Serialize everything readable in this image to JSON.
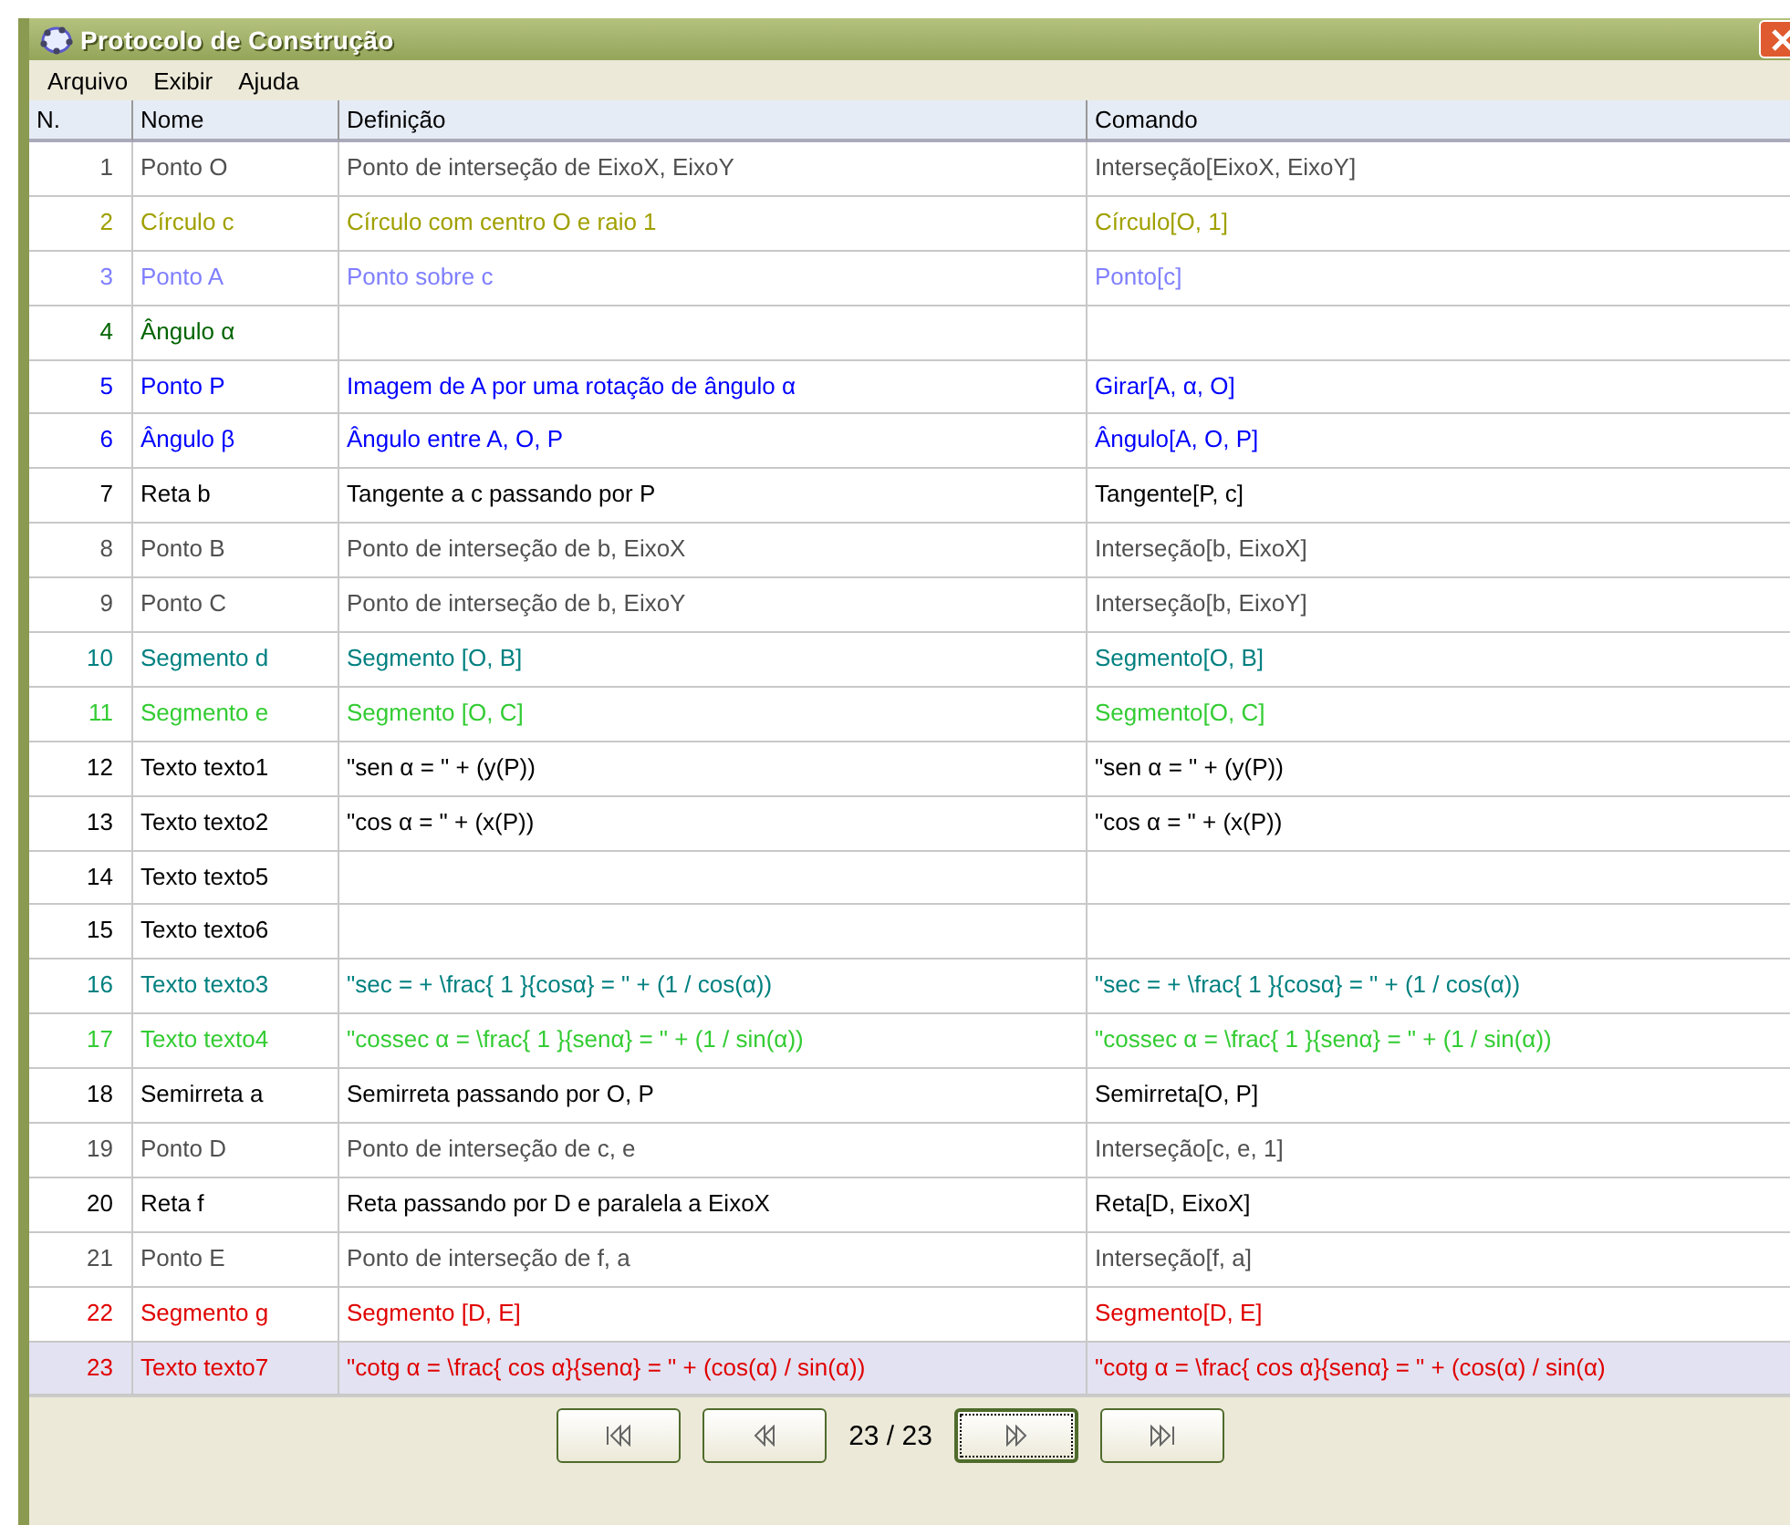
{
  "window": {
    "title": "Protocolo de Construção"
  },
  "menu": [
    "Arquivo",
    "Exibir",
    "Ajuda"
  ],
  "table": {
    "columns": [
      "N.",
      "Nome",
      "Definição",
      "Comando"
    ],
    "rows": [
      {
        "n": "1",
        "name": "Ponto O",
        "definition": "Ponto de interseção de EixoX, EixoY",
        "command": "Interseção[EixoX, EixoY]",
        "color": "#505050",
        "selected": false
      },
      {
        "n": "2",
        "name": "Círculo c",
        "definition": "Círculo com centro O e raio 1",
        "command": "Círculo[O, 1]",
        "color": "#a0a000",
        "selected": false
      },
      {
        "n": "3",
        "name": "Ponto A",
        "definition": "Ponto sobre c",
        "command": "Ponto[c]",
        "color": "#7f7fff",
        "selected": false
      },
      {
        "n": "4",
        "name": "Ângulo α",
        "definition": "",
        "command": "",
        "color": "#006400",
        "selected": false
      },
      {
        "n": "5",
        "name": "Ponto P",
        "definition": "Imagem de A por uma rotação de ângulo α",
        "command": "Girar[A, α, O]",
        "color": "#0000ff",
        "selected": false
      },
      {
        "n": "6",
        "name": "Ângulo β",
        "definition": "Ângulo entre A, O, P",
        "command": "Ângulo[A, O, P]",
        "color": "#0000ff",
        "selected": false
      },
      {
        "n": "7",
        "name": "Reta b",
        "definition": "Tangente a c passando por P",
        "command": "Tangente[P, c]",
        "color": "#000000",
        "selected": false
      },
      {
        "n": "8",
        "name": "Ponto B",
        "definition": "Ponto de interseção de b, EixoX",
        "command": "Interseção[b, EixoX]",
        "color": "#505050",
        "selected": false
      },
      {
        "n": "9",
        "name": "Ponto C",
        "definition": "Ponto de interseção de b, EixoY",
        "command": "Interseção[b, EixoY]",
        "color": "#505050",
        "selected": false
      },
      {
        "n": "10",
        "name": "Segmento d",
        "definition": "Segmento [O, B]",
        "command": "Segmento[O, B]",
        "color": "#008080",
        "selected": false
      },
      {
        "n": "11",
        "name": "Segmento e",
        "definition": "Segmento [O, C]",
        "command": "Segmento[O, C]",
        "color": "#33cc33",
        "selected": false
      },
      {
        "n": "12",
        "name": "Texto texto1",
        "definition": "\"sen α = \" + (y(P))",
        "command": "\"sen α = \" + (y(P))",
        "color": "#000000",
        "selected": false
      },
      {
        "n": "13",
        "name": "Texto texto2",
        "definition": "\"cos α = \" + (x(P))",
        "command": "\"cos α = \" + (x(P))",
        "color": "#000000",
        "selected": false
      },
      {
        "n": "14",
        "name": "Texto texto5",
        "definition": "",
        "command": "",
        "color": "#000000",
        "selected": false
      },
      {
        "n": "15",
        "name": "Texto texto6",
        "definition": "",
        "command": "",
        "color": "#000000",
        "selected": false
      },
      {
        "n": "16",
        "name": "Texto texto3",
        "definition": "\"sec = + \\frac{ 1 }{cosα} = \" + (1 / cos(α))",
        "command": "\"sec = + \\frac{ 1 }{cosα} = \" + (1 / cos(α))",
        "color": "#008080",
        "selected": false
      },
      {
        "n": "17",
        "name": "Texto texto4",
        "definition": "\"cossec α = \\frac{ 1 }{senα} = \" + (1 / sin(α))",
        "command": "\"cossec α = \\frac{ 1 }{senα} = \" + (1 / sin(α))",
        "color": "#33cc33",
        "selected": false
      },
      {
        "n": "18",
        "name": "Semirreta a",
        "definition": "Semirreta passando por O, P",
        "command": "Semirreta[O, P]",
        "color": "#000000",
        "selected": false
      },
      {
        "n": "19",
        "name": "Ponto D",
        "definition": "Ponto de interseção de c, e",
        "command": "Interseção[c, e, 1]",
        "color": "#505050",
        "selected": false
      },
      {
        "n": "20",
        "name": "Reta f",
        "definition": "Reta passando por D e paralela a EixoX",
        "command": "Reta[D, EixoX]",
        "color": "#000000",
        "selected": false
      },
      {
        "n": "21",
        "name": "Ponto E",
        "definition": "Ponto de interseção de f, a",
        "command": "Interseção[f, a]",
        "color": "#505050",
        "selected": false
      },
      {
        "n": "22",
        "name": "Segmento g",
        "definition": "Segmento [D, E]",
        "command": "Segmento[D, E]",
        "color": "#e00000",
        "selected": false
      },
      {
        "n": "23",
        "name": "Texto texto7",
        "definition": "\"cotg α = \\frac{ cos α}{senα} = \" + (cos(α) / sin(α))",
        "command": "\"cotg α = \\frac{ cos α}{senα} = \" + (cos(α) / sin(α)",
        "color": "#e00000",
        "selected": true
      }
    ]
  },
  "pager": {
    "label": "23 / 23",
    "buttons": [
      {
        "kind": "first",
        "focused": false
      },
      {
        "kind": "previous",
        "focused": false
      },
      {
        "kind": "next",
        "focused": true
      },
      {
        "kind": "last",
        "focused": false
      }
    ]
  }
}
